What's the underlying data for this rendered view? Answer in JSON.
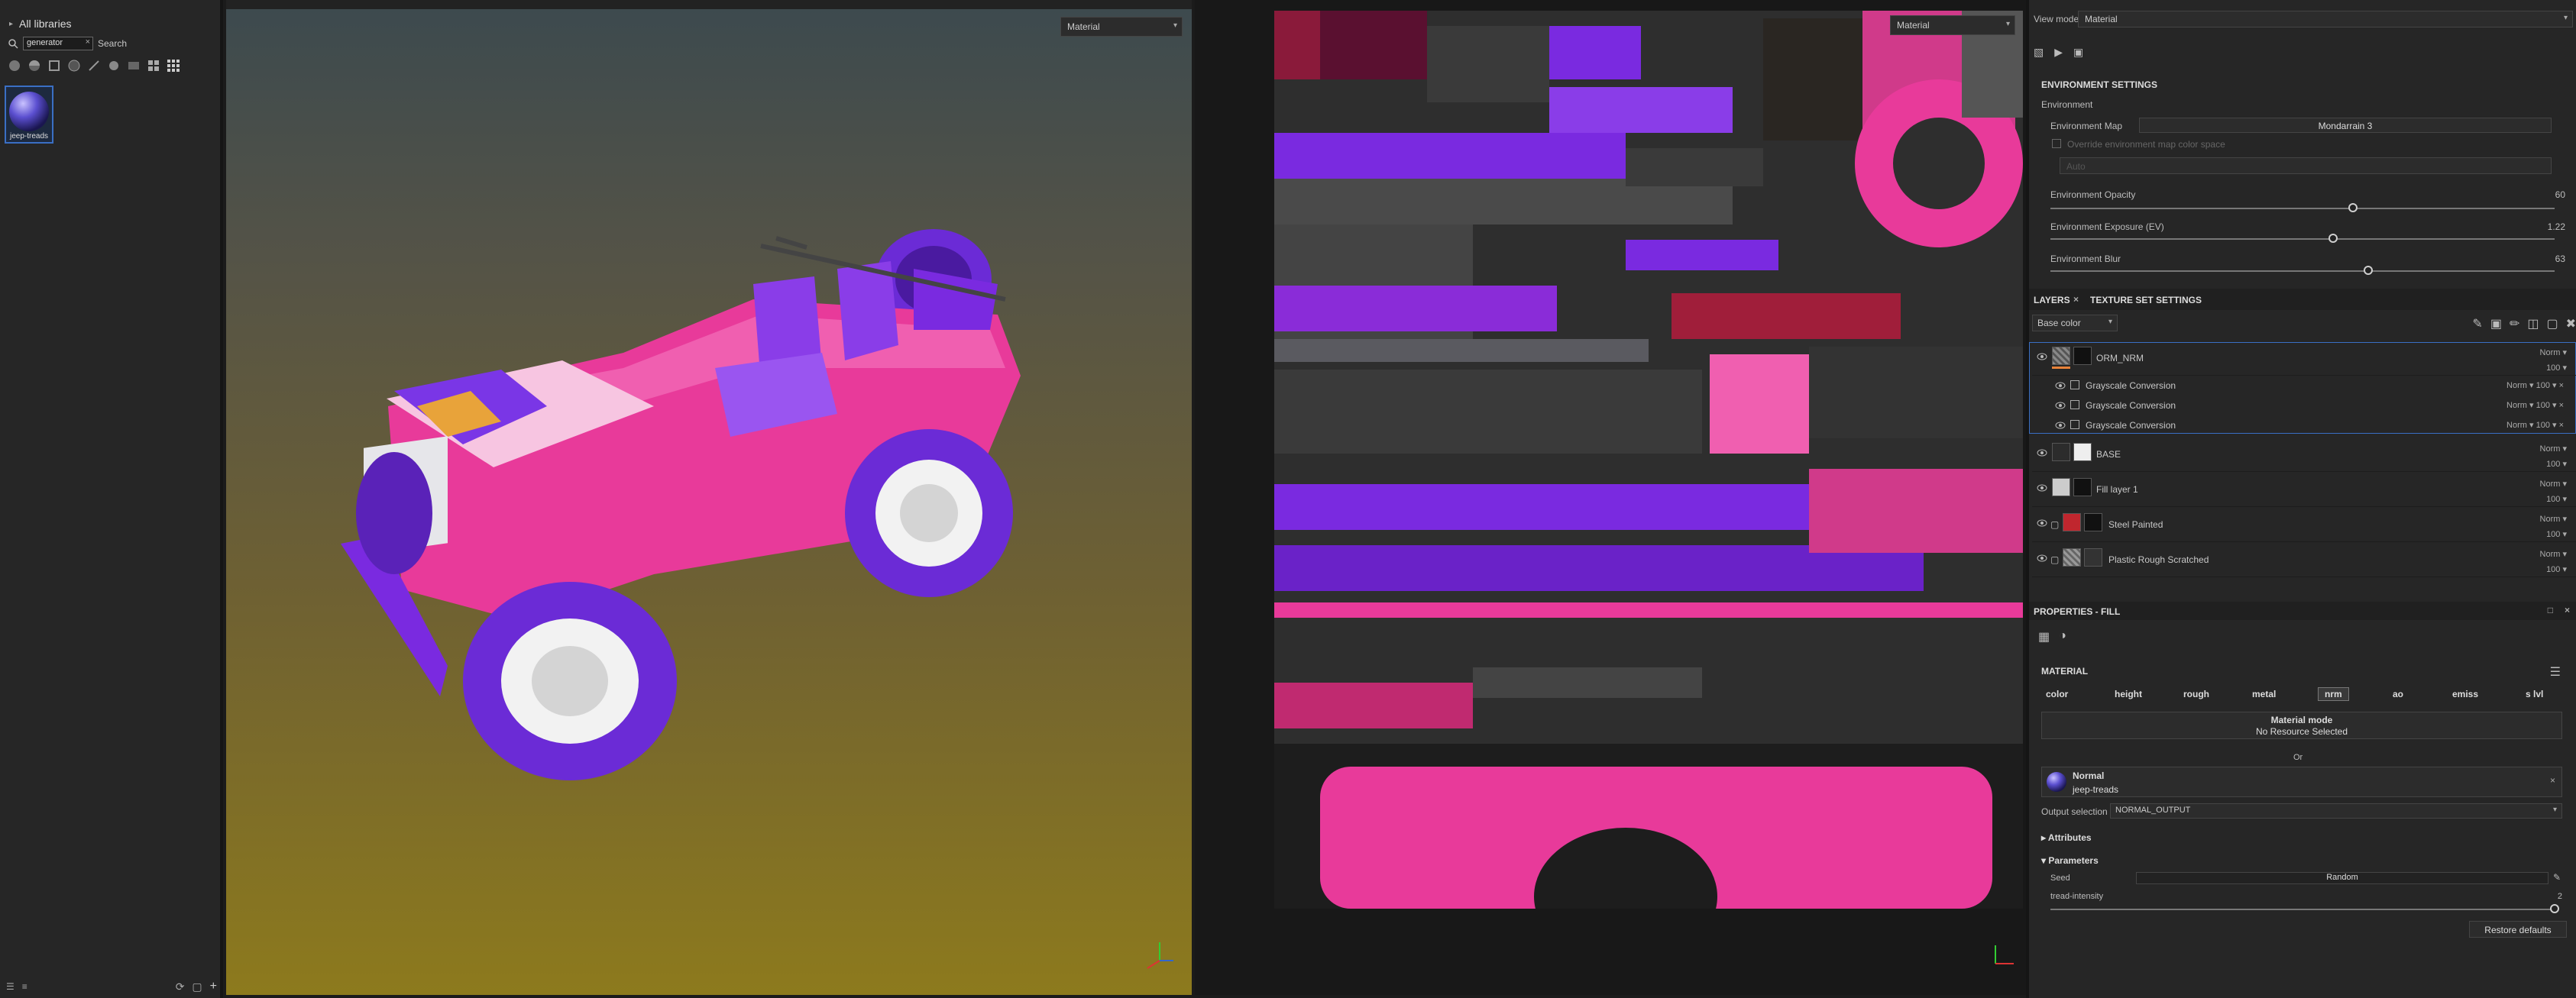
{
  "library": {
    "title": "All libraries",
    "search_value": "generator",
    "search_label": "Search",
    "thumb_label": "jeep-treads"
  },
  "viewport3d": {
    "mode": "Material"
  },
  "viewport2d": {
    "mode": "Material"
  },
  "environment": {
    "view_mode_label": "View mode",
    "view_mode_value": "Material",
    "section_title": "ENVIRONMENT SETTINGS",
    "env_label": "Environment",
    "env_map_label": "Environment Map",
    "env_map_value": "Mondarrain 3",
    "override_label": "Override environment map color space",
    "auto_value": "Auto",
    "opacity_label": "Environment Opacity",
    "opacity_value": "60",
    "opacity_fraction": 0.6,
    "exposure_label": "Environment Exposure (EV)",
    "exposure_value": "1.22",
    "exposure_fraction": 0.56,
    "blur_label": "Environment Blur",
    "blur_value": "63",
    "blur_fraction": 0.63
  },
  "layers": {
    "tab_layers": "LAYERS",
    "tab_texset": "TEXTURE SET SETTINGS",
    "channel_value": "Base color",
    "items": [
      {
        "name": "ORM_NRM",
        "mode": "Norm",
        "opacity": "100"
      },
      {
        "name": "BASE",
        "mode": "Norm",
        "opacity": "100"
      },
      {
        "name": "Fill layer 1",
        "mode": "Norm",
        "opacity": "100"
      },
      {
        "name": "Steel Painted",
        "mode": "Norm",
        "opacity": "100"
      },
      {
        "name": "Plastic Rough Scratched",
        "mode": "Norm",
        "opacity": "100"
      }
    ],
    "subs": [
      {
        "name": "Grayscale Conversion",
        "mode": "Norm",
        "opacity": "100"
      },
      {
        "name": "Grayscale Conversion",
        "mode": "Norm",
        "opacity": "100"
      },
      {
        "name": "Grayscale Conversion",
        "mode": "Norm",
        "opacity": "100"
      }
    ]
  },
  "properties": {
    "title": "PROPERTIES - FILL",
    "material_title": "MATERIAL",
    "channels": [
      "color",
      "height",
      "rough",
      "metal",
      "nrm",
      "ao",
      "emiss",
      "s lvl"
    ],
    "material_mode_label": "Material mode",
    "no_resource": "No Resource Selected",
    "or_label": "Or",
    "resource_type": "Normal",
    "resource_name": "jeep-treads",
    "output_label": "Output selection",
    "output_value": "NORMAL_OUTPUT",
    "attributes_label": "Attributes",
    "parameters_label": "Parameters",
    "seed_label": "Seed",
    "seed_value": "Random",
    "tread_label": "tread-intensity",
    "tread_value": "2",
    "restore_label": "Restore defaults"
  },
  "colors": {
    "accent": "#3a6fc4",
    "pink": "#e0317c",
    "purple": "#7a2ae0"
  }
}
